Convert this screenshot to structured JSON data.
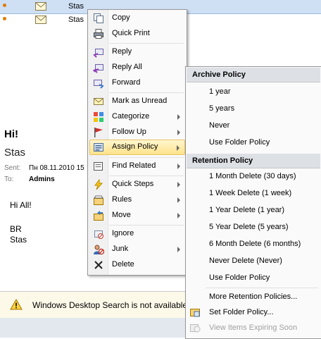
{
  "mail_list": [
    {
      "sender": "Stas"
    },
    {
      "sender": "Stas"
    }
  ],
  "reading_pane": {
    "subject": "Hi!",
    "from": "Stas",
    "sent_label": "Sent:",
    "sent_value": "Пн 08.11.2010 15",
    "to_label": "To:",
    "to_value": "Admins",
    "body_lines": [
      "Hi All!",
      "BR",
      "Stas"
    ]
  },
  "info_bar": {
    "message": "Windows Desktop Search is not available."
  },
  "context_menu": {
    "items": [
      {
        "label": "Copy",
        "icon": "copy-icon"
      },
      {
        "label": "Quick Print",
        "icon": "printer-icon"
      },
      {
        "label": "Reply",
        "icon": "reply-icon"
      },
      {
        "label": "Reply All",
        "icon": "reply-all-icon"
      },
      {
        "label": "Forward",
        "icon": "forward-icon"
      },
      {
        "label": "Mark as Unread",
        "icon": "envelope-icon"
      },
      {
        "label": "Categorize",
        "icon": "categorize-icon"
      },
      {
        "label": "Follow Up",
        "icon": "flag-icon"
      },
      {
        "label": "Assign Policy",
        "icon": "policy-icon"
      },
      {
        "label": "Find Related",
        "icon": "find-icon"
      },
      {
        "label": "Quick Steps",
        "icon": "lightning-icon"
      },
      {
        "label": "Rules",
        "icon": "rules-icon"
      },
      {
        "label": "Move",
        "icon": "move-icon"
      },
      {
        "label": "Ignore",
        "icon": "ignore-icon"
      },
      {
        "label": "Junk",
        "icon": "junk-icon"
      },
      {
        "label": "Delete",
        "icon": "delete-icon"
      }
    ]
  },
  "submenu": {
    "archive_header": "Archive Policy",
    "archive_items": [
      "1 year",
      "5 years",
      "Never",
      "Use Folder Policy"
    ],
    "retention_header": "Retention Policy",
    "retention_items": [
      "1 Month Delete (30 days)",
      "1 Week Delete (1 week)",
      "1 Year Delete (1 year)",
      "5 Year Delete (5 years)",
      "6 Month Delete (6 months)",
      "Never Delete (Never)",
      "Use Folder Policy"
    ],
    "more_policies": "More Retention Policies...",
    "set_folder_policy": "Set Folder Policy...",
    "view_expiring": "View Items Expiring Soon"
  },
  "colors": {
    "highlight": "#ffe38a",
    "info_bar": "#fdf9e9",
    "unread_dot": "#e07a00"
  }
}
